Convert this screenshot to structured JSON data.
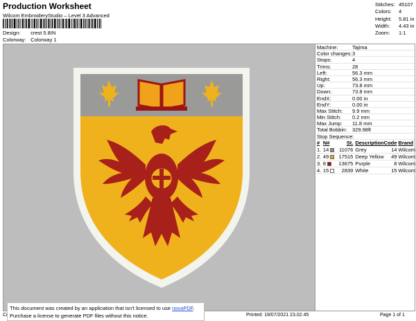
{
  "header": {
    "title": "Production Worksheet",
    "subtitle": "Wilcom EmbroideryStudio – Level 3 Advanced",
    "design_label": "Design:",
    "design_value": "crest 5.8IN",
    "colorway_label": "Colorway:",
    "colorway_value": "Colorway 1"
  },
  "stats": [
    {
      "label": "Stitches:",
      "value": "45107"
    },
    {
      "label": "Colors:",
      "value": "4"
    },
    {
      "label": "Height:",
      "value": "5.81 in"
    },
    {
      "label": "Width:",
      "value": "4.43 in"
    },
    {
      "label": "Zoom:",
      "value": "1:1"
    }
  ],
  "params": [
    {
      "label": "Machine:",
      "value": "Tajima"
    },
    {
      "label": "Color changes:",
      "value": "3"
    },
    {
      "label": "Stops:",
      "value": "4"
    },
    {
      "label": "Trims:",
      "value": "28"
    },
    {
      "label": "Left:",
      "value": "56.3 mm"
    },
    {
      "label": "Right:",
      "value": "56.3 mm"
    },
    {
      "label": "Up:",
      "value": "73.8 mm"
    },
    {
      "label": "Down:",
      "value": "73.8 mm"
    },
    {
      "label": "EndX:",
      "value": "0.00 in"
    },
    {
      "label": "EndY:",
      "value": "0.00 in"
    },
    {
      "label": "Max Stitch:",
      "value": "9.9 mm"
    },
    {
      "label": "Min Stitch:",
      "value": "0.2 mm"
    },
    {
      "label": "Max Jump:",
      "value": "11.8 mm"
    },
    {
      "label": "Total Bobbin:",
      "value": "329.98ft"
    }
  ],
  "stop_sequence": {
    "title": "Stop Sequence:",
    "columns": [
      "#",
      "N#",
      "St.",
      "Description",
      "Code",
      "Brand"
    ],
    "rows": [
      {
        "idx": "1.",
        "n": "14",
        "color": "#8c8c8c",
        "st": "11076",
        "desc": "Grey",
        "code": "14",
        "brand": "Wilcom"
      },
      {
        "idx": "2.",
        "n": "49",
        "color": "#f0a21a",
        "st": "17515",
        "desc": "Deep Yellow",
        "code": "49",
        "brand": "Wilcom"
      },
      {
        "idx": "3.",
        "n": "8",
        "color": "#9b1515",
        "st": "13675",
        "desc": "Purple",
        "code": "8",
        "brand": "Wilcom"
      },
      {
        "idx": "4.",
        "n": "15",
        "color": "#ffffff",
        "st": "2839",
        "desc": "White",
        "code": "15",
        "brand": "Wilcom"
      }
    ]
  },
  "notice": {
    "line1_prefix": "This document was created by an application that isn't licensed to use ",
    "link": "novaPDF",
    "line1_suffix": ".",
    "line2": "Purchase a license to generate PDF files without this notice."
  },
  "footer": {
    "left": "Cr",
    "printed": "Printed: 19/07/2021 23.02.45",
    "page": "Page 1 of 1"
  }
}
